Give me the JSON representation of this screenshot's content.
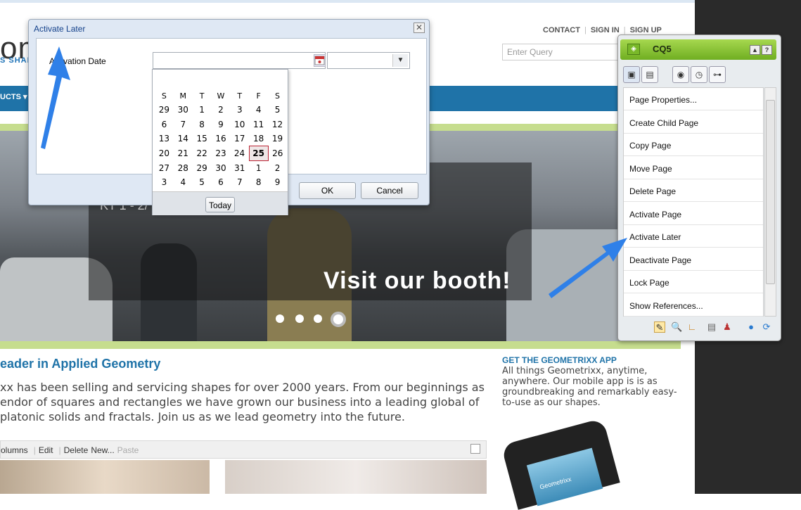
{
  "site": {
    "logo_text": "om",
    "tagline": "S SHAP",
    "top_links": [
      "CONTACT",
      "SIGN IN",
      "SIGN UP"
    ],
    "search_placeholder": "Enter Query",
    "nav_products": "UCTS ▾",
    "hero_caption": "Visit our booth!",
    "hero_partial": "KT 1 - 2/",
    "lead_title": "eader in Applied Geometry",
    "lead_text": "xx has been selling and servicing shapes for over 2000 years. From our beginnings as endor of squares and rectangles we have grown our business into a leading global of platonic solids and fractals. Join us as we lead geometry into the future.",
    "app_title": "GET THE GEOMETRIXX APP",
    "app_text": "All things Geometrixx, anytime, anywhere. Our mobile app is is as groundbreaking and remarkably easy-to-use as our shapes.",
    "phone_label": "Geometrixx",
    "editbar": {
      "columns": "olumns",
      "edit": "Edit",
      "delete": "Delete",
      "new": "New...",
      "paste": "Paste"
    }
  },
  "dialog": {
    "title": "Activate Later",
    "label": "Activation Date",
    "date_value": "",
    "time_value": "",
    "ok": "OK",
    "cancel": "Cancel"
  },
  "datepicker": {
    "weekdays": [
      "S",
      "M",
      "T",
      "W",
      "T",
      "F",
      "S"
    ],
    "weeks": [
      [
        "29",
        "30",
        "1",
        "2",
        "3",
        "4",
        "5"
      ],
      [
        "6",
        "7",
        "8",
        "9",
        "10",
        "11",
        "12"
      ],
      [
        "13",
        "14",
        "15",
        "16",
        "17",
        "18",
        "19"
      ],
      [
        "20",
        "21",
        "22",
        "23",
        "24",
        "25",
        "26"
      ],
      [
        "27",
        "28",
        "29",
        "30",
        "31",
        "1",
        "2"
      ],
      [
        "3",
        "4",
        "5",
        "6",
        "7",
        "8",
        "9"
      ]
    ],
    "today_day": "25",
    "today_label": "Today"
  },
  "sidekick": {
    "title": "CQ5",
    "tabs": [
      "page-tab-icon",
      "components-tab-icon",
      "workflow-tab-icon",
      "versioning-tab-icon",
      "sitemap-tab-icon"
    ],
    "items": [
      "Page Properties...",
      "Create Child Page",
      "Copy Page",
      "Move Page",
      "Delete Page",
      "Activate Page",
      "Activate Later",
      "Deactivate Page",
      "Lock Page",
      "Show References..."
    ],
    "footer_icons": [
      "edit-mode-icon",
      "preview-icon",
      "design-icon",
      "scaffolding-icon",
      "client-context-icon",
      "website-admin-icon",
      "refresh-icon"
    ]
  },
  "colors": {
    "accent": "#1f73a8",
    "green": "#c6dd8e",
    "sidekick_header": "#7fbf2a",
    "arrow": "#2f80e8"
  }
}
